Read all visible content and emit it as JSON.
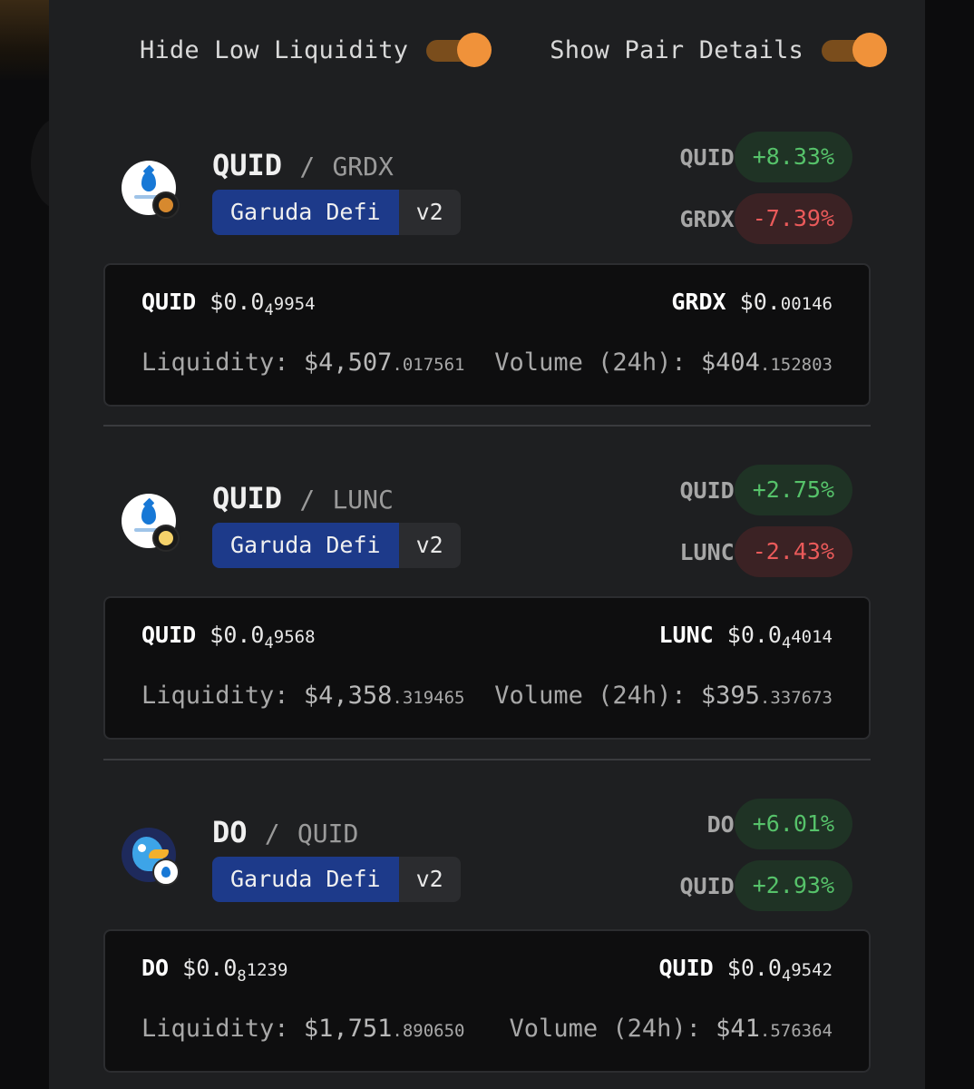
{
  "toggles": {
    "hide_low_liquidity": {
      "label": "Hide Low Liquidity",
      "on": true
    },
    "show_pair_details": {
      "label": "Show Pair Details",
      "on": true
    }
  },
  "colors": {
    "accent": "#f0923a",
    "dex_chip": "#1d3a8a",
    "up": "#56c26a",
    "down": "#ea5a5a"
  },
  "pairs": [
    {
      "base": "QUID",
      "slash": "/",
      "quote": "GRDX",
      "dex": "Garuda Defi",
      "version": "v2",
      "changes": [
        {
          "symbol": "QUID",
          "value": "+8.33%",
          "direction": "up"
        },
        {
          "symbol": "GRDX",
          "value": "-7.39%",
          "direction": "down"
        }
      ],
      "base_price": {
        "symbol": "QUID",
        "prefix": "$0.0",
        "zeros": "4",
        "digits": "9954"
      },
      "quote_price": {
        "symbol": "GRDX",
        "prefix": "$0.",
        "zeros": "",
        "digits": "00146"
      },
      "liquidity": {
        "label": "Liquidity:",
        "main": "$4,507",
        "decimals": ".017561"
      },
      "volume": {
        "label": "Volume (24h):",
        "main": "$404",
        "decimals": ".152803"
      }
    },
    {
      "base": "QUID",
      "slash": "/",
      "quote": "LUNC",
      "dex": "Garuda Defi",
      "version": "v2",
      "changes": [
        {
          "symbol": "QUID",
          "value": "+2.75%",
          "direction": "up"
        },
        {
          "symbol": "LUNC",
          "value": "-2.43%",
          "direction": "down"
        }
      ],
      "base_price": {
        "symbol": "QUID",
        "prefix": "$0.0",
        "zeros": "4",
        "digits": "9568"
      },
      "quote_price": {
        "symbol": "LUNC",
        "prefix": "$0.0",
        "zeros": "4",
        "digits": "4014"
      },
      "liquidity": {
        "label": "Liquidity:",
        "main": "$4,358",
        "decimals": ".319465"
      },
      "volume": {
        "label": "Volume (24h):",
        "main": "$395",
        "decimals": ".337673"
      }
    },
    {
      "base": "DO",
      "slash": "/",
      "quote": "QUID",
      "dex": "Garuda Defi",
      "version": "v2",
      "changes": [
        {
          "symbol": "DO",
          "value": "+6.01%",
          "direction": "up"
        },
        {
          "symbol": "QUID",
          "value": "+2.93%",
          "direction": "up"
        }
      ],
      "base_price": {
        "symbol": "DO",
        "prefix": "$0.0",
        "zeros": "8",
        "digits": "1239"
      },
      "quote_price": {
        "symbol": "QUID",
        "prefix": "$0.0",
        "zeros": "4",
        "digits": "9542"
      },
      "liquidity": {
        "label": "Liquidity:",
        "main": "$1,751",
        "decimals": ".890650"
      },
      "volume": {
        "label": "Volume (24h):",
        "main": "$41",
        "decimals": ".576364"
      }
    }
  ]
}
